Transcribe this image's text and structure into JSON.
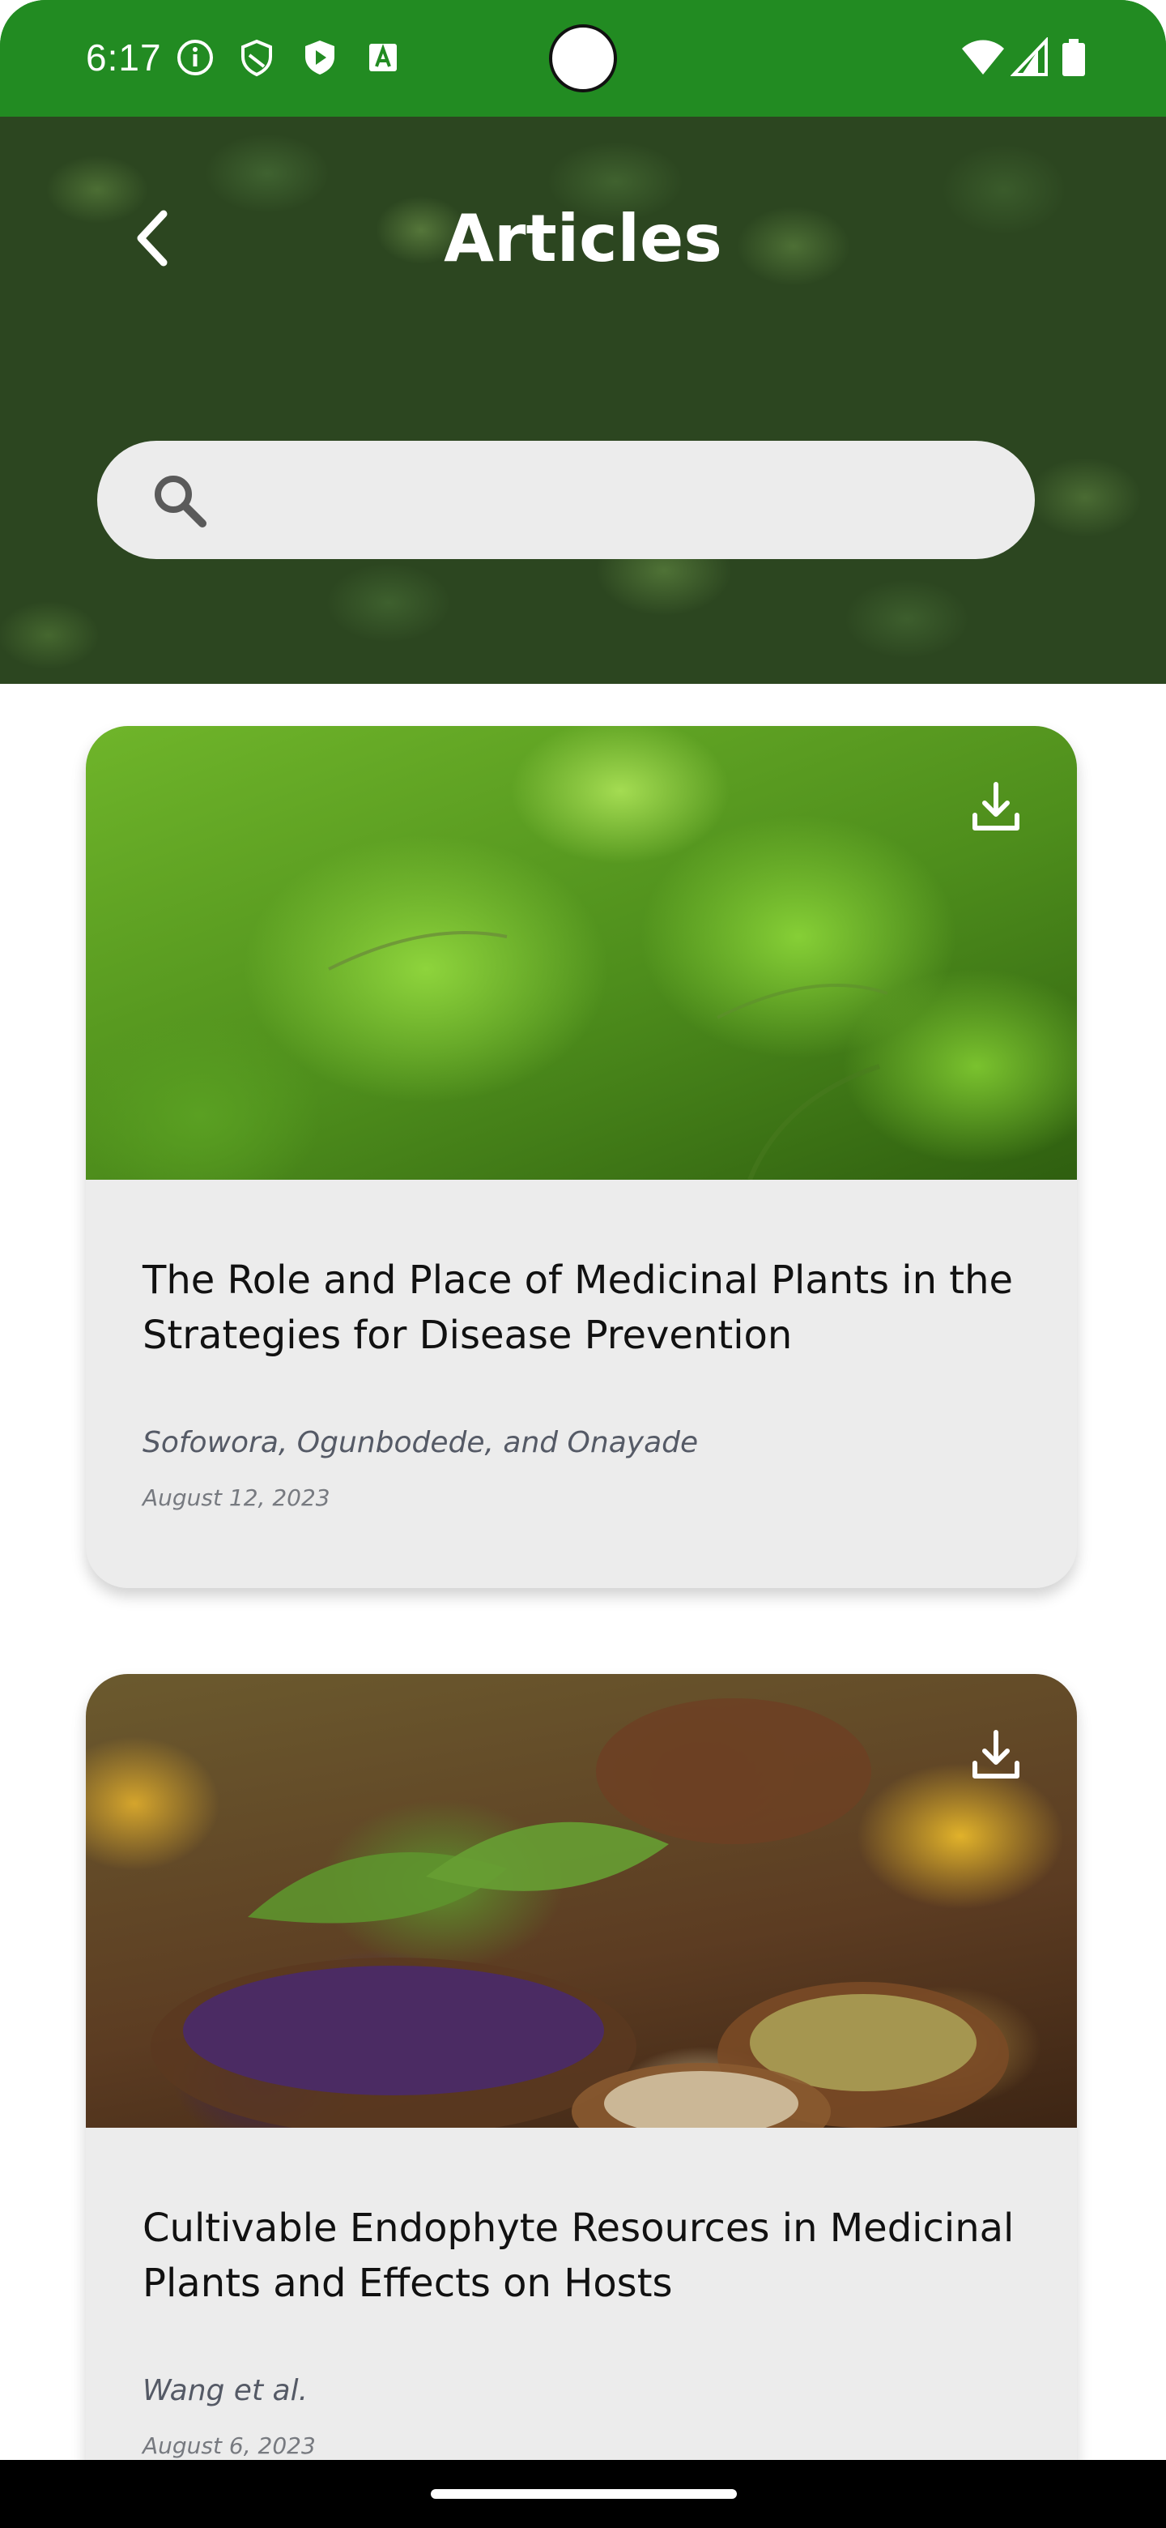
{
  "status_bar": {
    "time": "6:17",
    "icons": [
      "info-icon",
      "shield-icon",
      "play-shield-icon",
      "keyboard-a-icon",
      "wifi-icon",
      "signal-icon",
      "battery-icon"
    ],
    "background_color": "#228b22"
  },
  "header": {
    "title": "Articles",
    "back_icon": "chevron-left-icon",
    "search": {
      "icon": "search-icon",
      "value": "",
      "placeholder": ""
    }
  },
  "articles": [
    {
      "title": "The Role and Place of Medicinal Plants in the Strategies for Disease Prevention",
      "authors": "Sofowora, Ogunbodede, and Onayade",
      "date": "August 12, 2023",
      "image": "green-mint-leaves",
      "action_icon": "download-icon"
    },
    {
      "title": "Cultivable Endophyte Resources in Medicinal Plants and Effects on Hosts",
      "authors": "Wang et al.",
      "date": "August 6, 2023",
      "image": "herbs-in-wooden-bowls",
      "action_icon": "download-icon"
    }
  ],
  "colors": {
    "card_background": "#ececec",
    "title_text": "#111111",
    "author_text": "#555a66",
    "date_text": "#777a80"
  }
}
